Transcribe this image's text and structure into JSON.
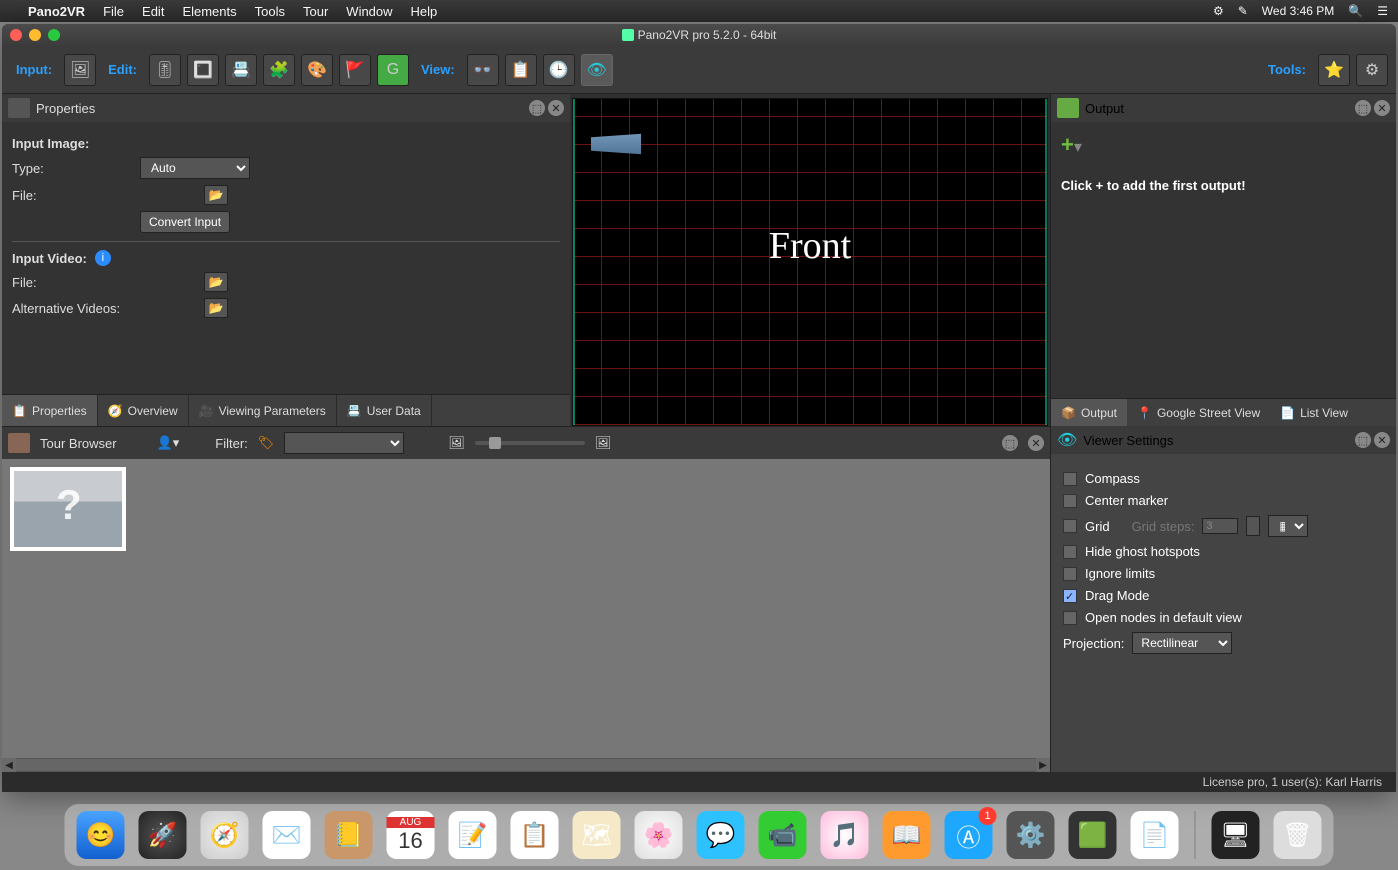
{
  "menubar": {
    "appname": "Pano2VR",
    "items": [
      "File",
      "Edit",
      "Elements",
      "Tools",
      "Tour",
      "Window",
      "Help"
    ],
    "clock": "Wed 3:46 PM"
  },
  "window": {
    "title": "Pano2VR pro 5.2.0 - 64bit"
  },
  "toolbar": {
    "input": "Input:",
    "edit": "Edit:",
    "view": "View:",
    "tools": "Tools:"
  },
  "properties": {
    "title": "Properties",
    "input_image": "Input Image:",
    "type_label": "Type:",
    "type_value": "Auto",
    "file_label": "File:",
    "convert": "Convert Input",
    "input_video": "Input Video:",
    "file2_label": "File:",
    "alt_videos": "Alternative Videos:",
    "tabs": [
      "Properties",
      "Overview",
      "Viewing Parameters",
      "User Data"
    ]
  },
  "viewport": {
    "face": "Front"
  },
  "output": {
    "title": "Output",
    "hint": "Click + to add the first output!",
    "tabs": [
      "Output",
      "Google Street View",
      "List View"
    ]
  },
  "tour": {
    "title": "Tour Browser",
    "filter": "Filter:"
  },
  "viewer": {
    "title": "Viewer Settings",
    "compass": "Compass",
    "center": "Center marker",
    "grid": "Grid",
    "grid_steps": "Grid steps:",
    "grid_steps_val": "3",
    "ghost": "Hide ghost hotspots",
    "ignore": "Ignore limits",
    "drag": "Drag Mode",
    "open_nodes": "Open nodes in default view",
    "proj_label": "Projection:",
    "proj_value": "Rectilinear"
  },
  "footer": {
    "license": "License pro, 1 user(s): Karl Harris"
  },
  "dock": {
    "date_month": "AUG",
    "date_day": "16",
    "badge": "1"
  }
}
